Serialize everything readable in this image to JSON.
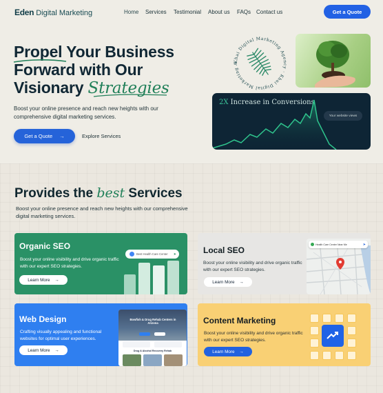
{
  "nav": {
    "logo_brand": "Eden",
    "logo_rest": " Digital Marketing",
    "links": [
      "Home",
      "Services",
      "Testimonial",
      "About us",
      "FAQs",
      "Contact us"
    ],
    "cta": "Get a Quote"
  },
  "hero": {
    "title_word1": "Propel",
    "title_rest1": " Your Business",
    "title_line2": "Forward with Our",
    "title_line3a": "Visionary ",
    "title_script": "Strategies",
    "subtitle": "Boost your online presence and reach new heights with our comprehensive digital marketing services.",
    "cta_primary": "Get a Quote",
    "cta_secondary": "Explore Services",
    "badge_text": "Khai Digital Marketing Agency · Khai Digital Marketing Agency · ",
    "conversion_prefix": "2X",
    "conversion_text": " Increase in Conversions",
    "conversion_pill": "Your website views"
  },
  "services": {
    "title_a": "Provides the ",
    "title_script": "best",
    "title_b": " Services",
    "subtitle": "Boost your online presence and reach new heights with our comprehensive digital marketing services.",
    "cards": [
      {
        "title": "Organic SEO",
        "desc": "Boost your online visibility and drive organic traffic with our expert SEO strategies.",
        "button": "Learn More",
        "search_text": "Best Health Care Center"
      },
      {
        "title": "Local SEO",
        "desc": "Boost your online visibility and drive organic traffic with our expert SEO strategies.",
        "button": "Learn More",
        "search_text": "Health Care Center Near Me"
      },
      {
        "title": "Web Design",
        "desc": "Crafting visually appealing and functional websites for optimal user experiences.",
        "button": "Learn More",
        "site_heading": "Bowfish & Drug Rehab Centers in Arizona",
        "site_section": "Drug & Alcohol Recovery Rehab"
      },
      {
        "title": "Content Marketing",
        "desc": "Boost your online visibility and drive organic traffic with our expert SEO strategies.",
        "button": "Learn More"
      }
    ]
  },
  "colors": {
    "primary_blue": "#2563d9",
    "brand_green": "#218059",
    "organic_green": "#2a9166",
    "web_blue": "#2f7ff0",
    "content_yellow": "#f9d074",
    "dark_navy": "#0e2535"
  }
}
